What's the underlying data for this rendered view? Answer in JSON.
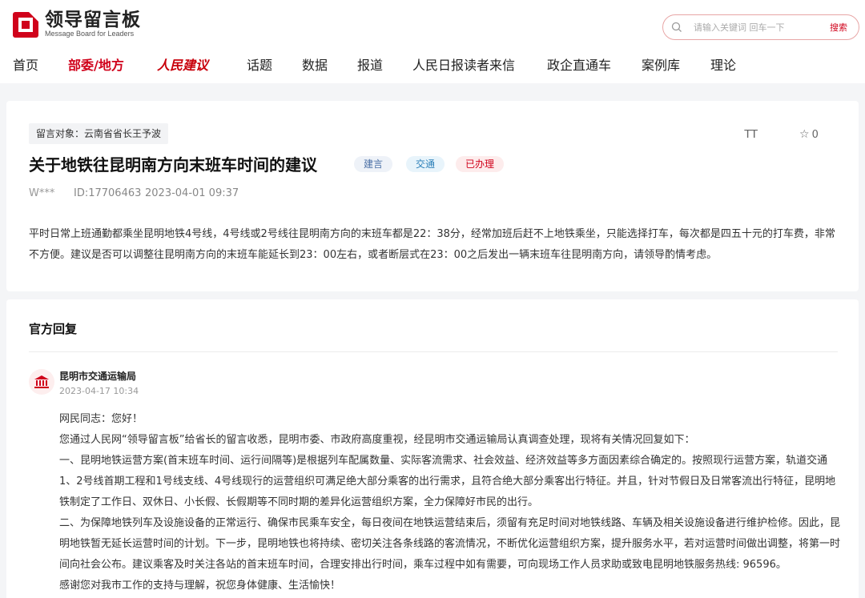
{
  "header": {
    "logo_title": "领导留言板",
    "logo_subtitle": "Message Board for Leaders",
    "search_placeholder": "请输入关键词 回车一下",
    "search_button": "搜索"
  },
  "nav": [
    "首页",
    "部委/地方",
    "人民建议",
    "话题",
    "数据",
    "报道",
    "人民日报读者来信",
    "政企直通车",
    "案例库",
    "理论"
  ],
  "message": {
    "target": "留言对象：云南省省长王予波",
    "title": "关于地铁往昆明南方向末班车时间的建议",
    "tags": [
      "建言",
      "交通",
      "已办理"
    ],
    "author": "W***",
    "id": "ID:17706463",
    "time": "2023-04-01 09:37",
    "font_toggle": "TT",
    "star_count": "0",
    "body": "平时日常上班通勤都乘坐昆明地铁4号线，4号线或2号线往昆明南方向的末班车都是22：38分，经常加班后赶不上地铁乘坐，只能选择打车，每次都是四五十元的打车费，非常不方便。建议是否可以调整往昆明南方向的末班车能延长到23：00左右，或者断层式在23：00之后发出一辆末班车往昆明南方向，请领导酌情考虑。"
  },
  "reply": {
    "heading": "官方回复",
    "org": "昆明市交通运输局",
    "time": "2023-04-17 10:34",
    "paragraphs": [
      "网民同志：您好！",
      "您通过人民网“领导留言板”给省长的留言收悉，昆明市委、市政府高度重视，经昆明市交通运输局认真调查处理，现将有关情况回复如下：",
      "一、昆明地铁运营方案(首末班车时间、运行间隔等)是根据列车配属数量、实际客流需求、社会效益、经济效益等多方面因素综合确定的。按照现行运营方案，轨道交通1、2号线首期工程和1号线支线、4号线现行的运营组织可满足绝大部分乘客的出行需求，且符合绝大部分乘客出行特征。并且，针对节假日及日常客流出行特征，昆明地铁制定了工作日、双休日、小长假、长假期等不同时期的差异化运营组织方案，全力保障好市民的出行。",
      "二、为保障地铁列车及设施设备的正常运行、确保市民乘车安全，每日夜间在地铁运营结束后，须留有充足时间对地铁线路、车辆及相关设施设备进行维护检修。因此，昆明地铁暂无延长运营时间的计划。下一步，昆明地铁也将持续、密切关注各条线路的客流情况，不断优化运营组织方案，提升服务水平，若对运营时间做出调整，将第一时间向社会公布。建议乘客及时关注各站的首末班车时间，合理安排出行时间，乘车过程中如有需要，可向现场工作人员求助或致电昆明地铁服务热线: 96596。",
      "感谢您对我市工作的支持与理解，祝您身体健康、生活愉快！"
    ]
  },
  "colors": {
    "accent": "#d0021b"
  }
}
